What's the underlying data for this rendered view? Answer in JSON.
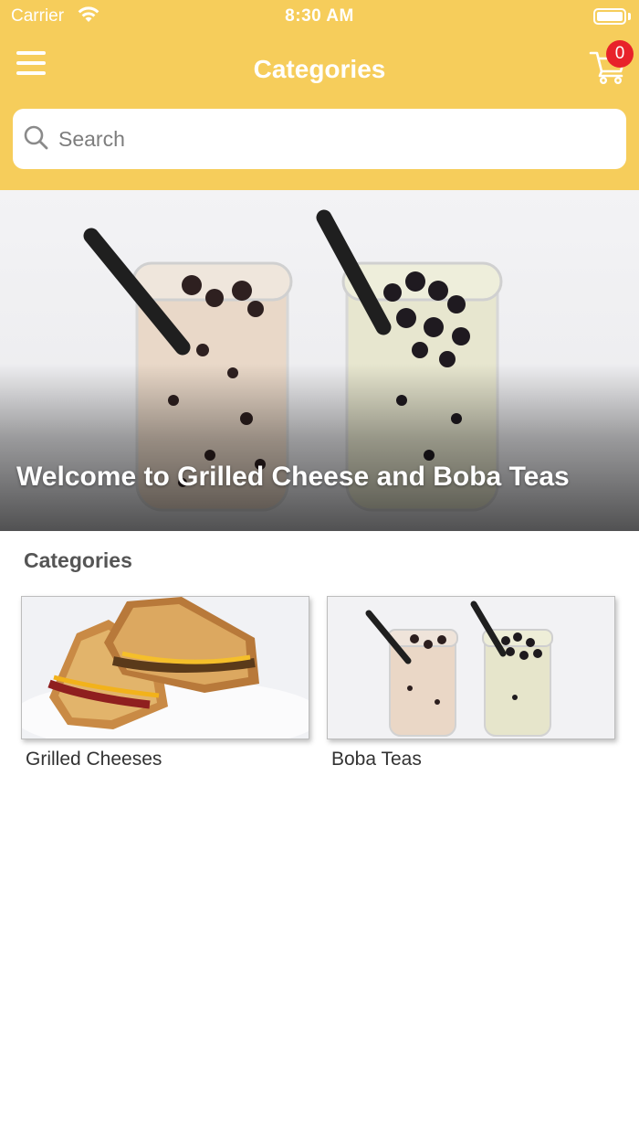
{
  "status_bar": {
    "carrier": "Carrier",
    "time": "8:30 AM"
  },
  "nav": {
    "title": "Categories",
    "menu_icon": "hamburger-menu-icon",
    "cart_icon": "shopping-cart-icon",
    "cart_count": "0"
  },
  "search": {
    "placeholder": "Search",
    "value": "",
    "icon": "search-icon"
  },
  "hero": {
    "title": "Welcome to Grilled Cheese and Boba Teas"
  },
  "section": {
    "title": "Categories"
  },
  "categories": [
    {
      "label": "Grilled Cheeses"
    },
    {
      "label": "Boba Teas"
    }
  ],
  "colors": {
    "accent": "#F6CD5B",
    "badge": "#E8222A",
    "header_text": "#FFFFFF"
  }
}
